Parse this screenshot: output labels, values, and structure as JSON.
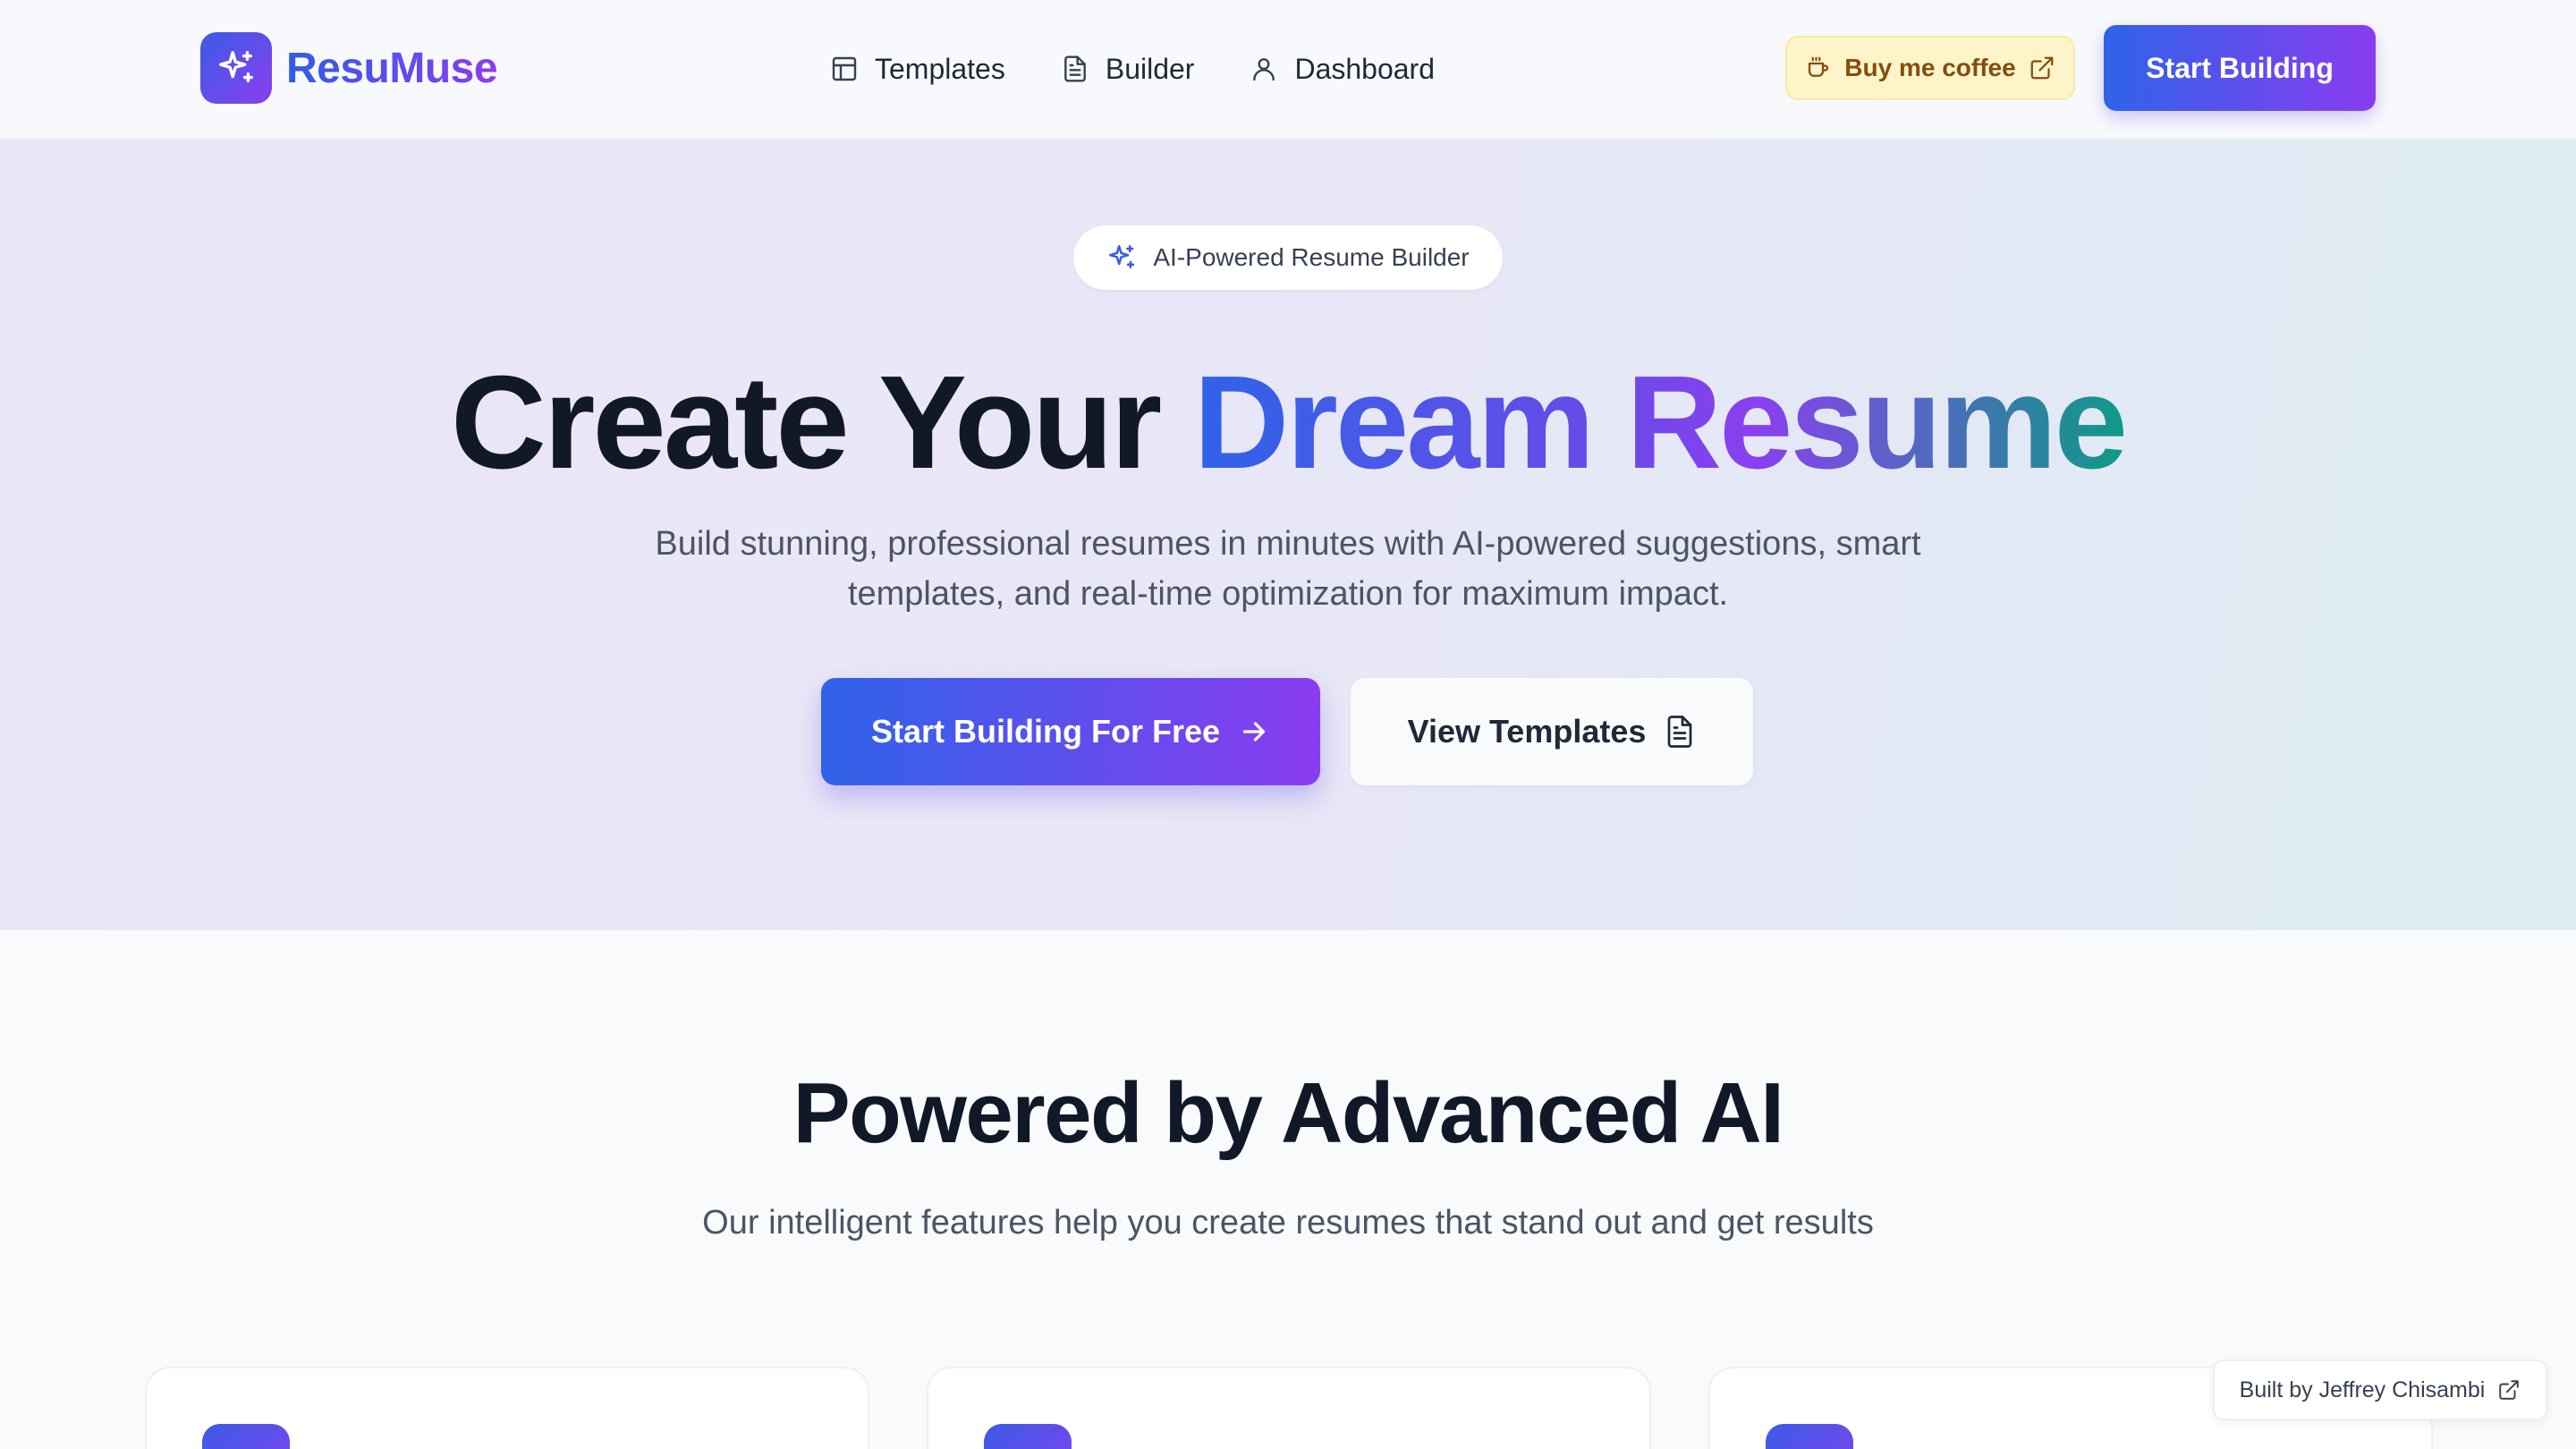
{
  "header": {
    "logo_text": "ResuMuse",
    "nav": [
      {
        "label": "Templates",
        "icon": "layout-icon"
      },
      {
        "label": "Builder",
        "icon": "file-text-icon"
      },
      {
        "label": "Dashboard",
        "icon": "user-icon"
      }
    ],
    "coffee_label": "Buy me coffee",
    "start_label": "Start Building"
  },
  "hero": {
    "badge": "AI-Powered Resume Builder",
    "title_plain": "Create Your ",
    "title_gradient": "Dream Resume",
    "subtitle": "Build stunning, professional resumes in minutes with AI-powered suggestions, smart templates, and real-time optimization for maximum impact.",
    "primary_cta": "Start Building For Free",
    "secondary_cta": "View Templates"
  },
  "features": {
    "title": "Powered by Advanced AI",
    "subtitle": "Our intelligent features help you create resumes that stand out and get results"
  },
  "footer_badge": "Built by Jeffrey Chisambi",
  "colors": {
    "brand_blue": "#2f63e8",
    "brand_purple": "#8a3cf0",
    "brand_teal": "#0f9a86",
    "coffee_bg": "#fdf5c9",
    "coffee_text": "#854d0e",
    "text_dark": "#111827",
    "text_muted": "#4b5563"
  }
}
